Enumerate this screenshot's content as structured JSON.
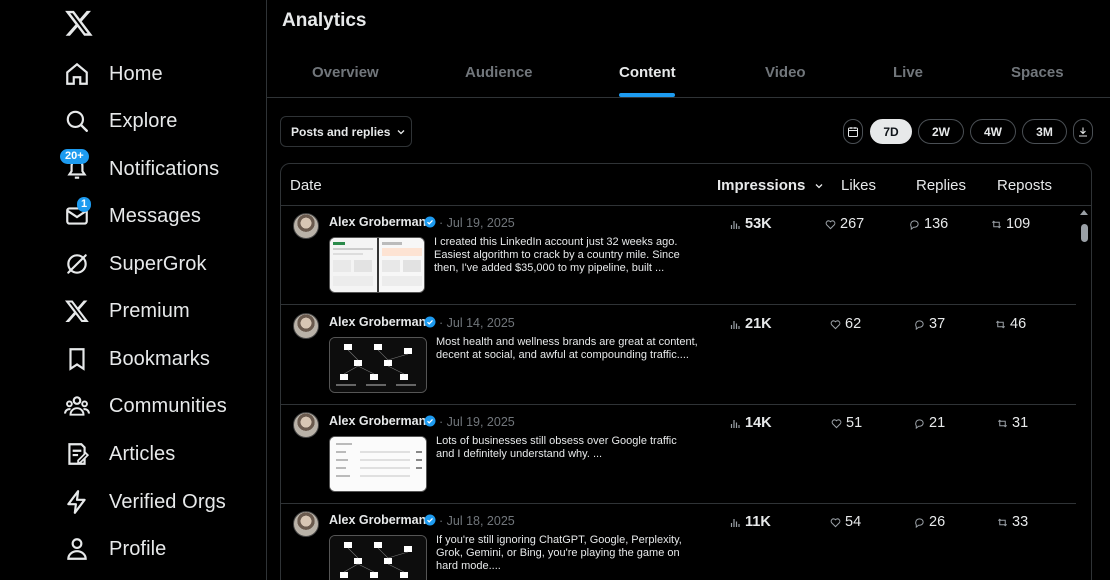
{
  "sidebar": {
    "items": [
      {
        "label": "Home",
        "icon": "home-icon"
      },
      {
        "label": "Explore",
        "icon": "search-icon"
      },
      {
        "label": "Notifications",
        "icon": "bell-icon",
        "badge": "20+"
      },
      {
        "label": "Messages",
        "icon": "mail-icon",
        "badge": "1"
      },
      {
        "label": "SuperGrok",
        "icon": "grok-icon"
      },
      {
        "label": "Premium",
        "icon": "x-logo-icon"
      },
      {
        "label": "Bookmarks",
        "icon": "bookmark-icon"
      },
      {
        "label": "Communities",
        "icon": "communities-icon"
      },
      {
        "label": "Articles",
        "icon": "article-icon"
      },
      {
        "label": "Verified Orgs",
        "icon": "lightning-icon"
      },
      {
        "label": "Profile",
        "icon": "person-icon"
      }
    ]
  },
  "page": {
    "title": "Analytics"
  },
  "tabs": [
    {
      "label": "Overview"
    },
    {
      "label": "Audience"
    },
    {
      "label": "Content",
      "active": true
    },
    {
      "label": "Video"
    },
    {
      "label": "Live"
    },
    {
      "label": "Spaces"
    }
  ],
  "filter": {
    "label": "Posts and replies"
  },
  "ranges": [
    "7D",
    "2W",
    "4W",
    "3M"
  ],
  "table": {
    "headers": {
      "date": "Date",
      "impressions": "Impressions",
      "likes": "Likes",
      "replies": "Replies",
      "reposts": "Reposts"
    },
    "rows": [
      {
        "author": "Alex Groberman",
        "date": "· Jul 19, 2025",
        "text": "I created this LinkedIn account just 32 weeks ago. Easiest algorithm to crack by a country mile. Since then, I've added $35,000 to my pipeline, built ...",
        "impressions": "53K",
        "likes": "267",
        "replies": "136",
        "reposts": "109"
      },
      {
        "author": "Alex Groberman",
        "date": "· Jul 14, 2025",
        "text": "Most health and wellness brands are great at content, decent at social, and awful at compounding traffic....",
        "impressions": "21K",
        "likes": "62",
        "replies": "37",
        "reposts": "46"
      },
      {
        "author": "Alex Groberman",
        "date": "· Jul 19, 2025",
        "text": "Lots of businesses still obsess over Google traffic and I definitely understand why. ...",
        "impressions": "14K",
        "likes": "51",
        "replies": "21",
        "reposts": "31"
      },
      {
        "author": "Alex Groberman",
        "date": "· Jul 18, 2025",
        "text": "If you're still ignoring ChatGPT, Google, Perplexity, Grok, Gemini, or Bing, you're playing the game on hard mode....",
        "impressions": "11K",
        "likes": "54",
        "replies": "26",
        "reposts": "33"
      }
    ]
  },
  "colors": {
    "accent": "#1d9bf0",
    "background": "#000000",
    "text": "#e7e9ea",
    "muted": "#71767b",
    "border": "#2f3336"
  }
}
